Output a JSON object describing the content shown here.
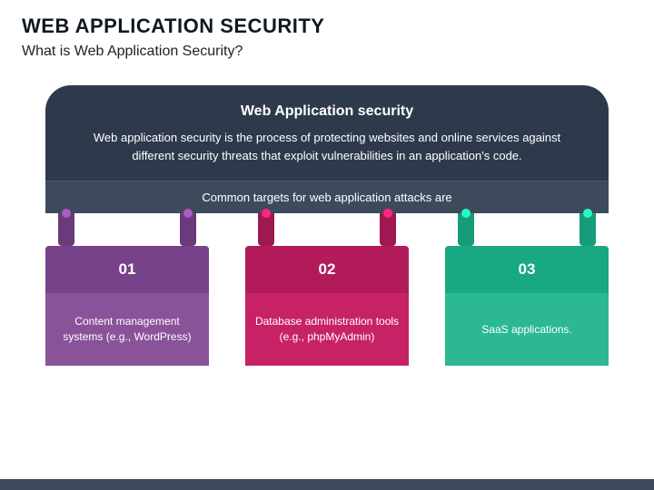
{
  "header": {
    "title": "WEB APPLICATION SECURITY",
    "subtitle": "What is Web Application Security?"
  },
  "panel": {
    "title": "Web Application security",
    "description": "Web application security is the process of protecting websites and online services against different security threats that exploit vulnerabilities in an application's code."
  },
  "subbar": {
    "text": "Common targets for web application attacks are"
  },
  "cards": [
    {
      "num": "01",
      "text": "Content management systems (e.g., WordPress)"
    },
    {
      "num": "02",
      "text": "Database administration tools (e.g., phpMyAdmin)"
    },
    {
      "num": "03",
      "text": "SaaS applications."
    }
  ]
}
